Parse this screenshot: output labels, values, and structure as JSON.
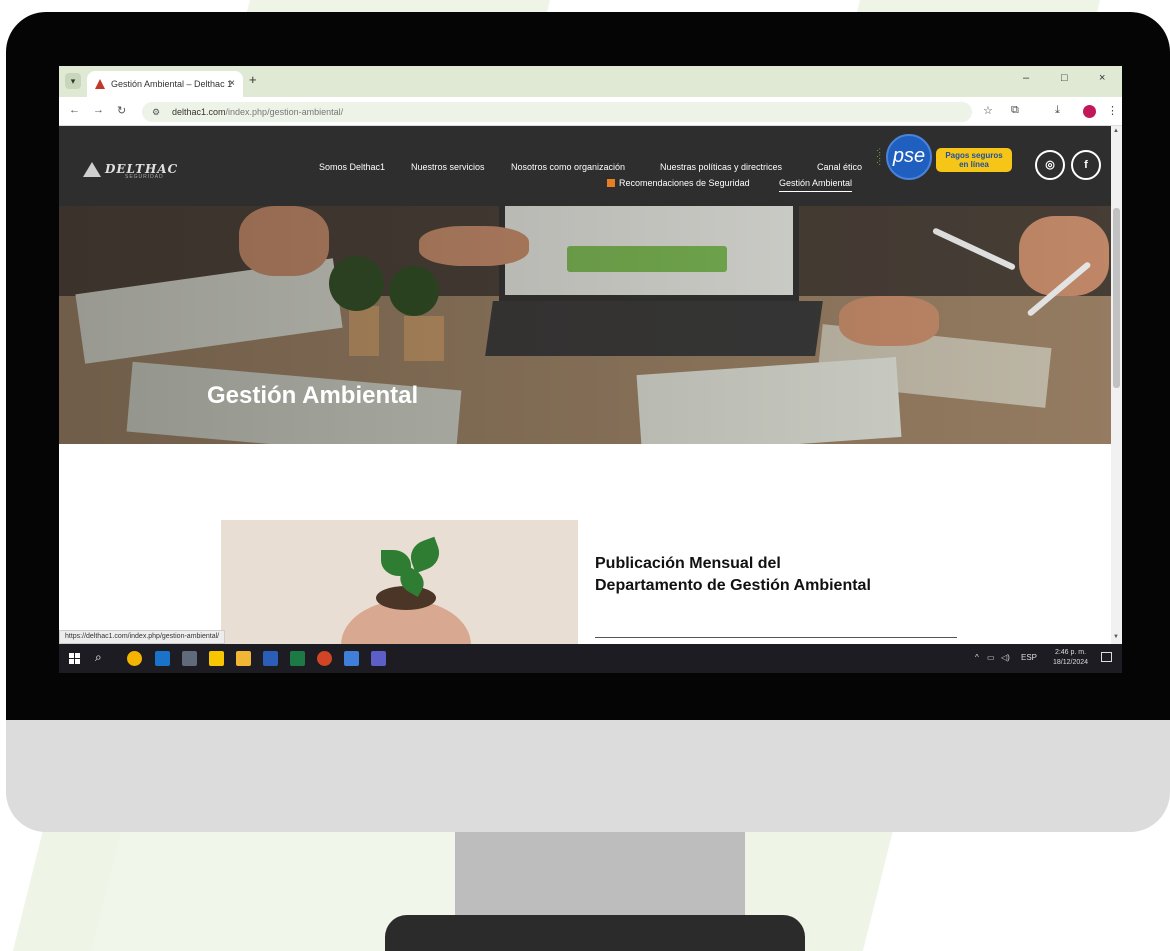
{
  "browser": {
    "tab_title": "Gestión Ambiental – Delthac 1",
    "tab_close": "×",
    "new_tab": "+",
    "url_host": "delthac1.com",
    "url_path": "/index.php/gestion-ambiental/",
    "window_controls": [
      "–",
      "□",
      "×"
    ]
  },
  "site": {
    "logo_text": "DELTHAC",
    "logo_subtext": "SEGURIDAD",
    "nav_row1": [
      "Somos Delthac1",
      "Nuestros servicios",
      "Nosotros como organización",
      "Nuestras políticas y directrices",
      "Canal ético"
    ],
    "nav_row2": [
      "Recomendaciones de Seguridad",
      "Gestión Ambiental"
    ],
    "active_nav": "Gestión Ambiental",
    "pse_label": "pse",
    "pse_pill": [
      "Pagos seguros",
      "en línea"
    ],
    "social": [
      "instagram",
      "facebook"
    ],
    "hero_title": "Gestión Ambiental",
    "publication_title_line1": "Publicación Mensual del",
    "publication_title_line2": "Departamento de Gestión Ambiental"
  },
  "status_bar": {
    "hover_url": "https://delthac1.com/index.php/gestion-ambiental/"
  },
  "taskbar": {
    "language": "ESP",
    "time": "2:46 p. m.",
    "date": "18/12/2024",
    "apps": [
      "chrome",
      "outlook",
      "calculator",
      "sticky-notes",
      "file-explorer",
      "word",
      "excel",
      "powerpoint",
      "photos",
      "teams"
    ]
  },
  "colors": {
    "site_header": "#2e2e2e",
    "pse_blue": "#1f5fbf",
    "pse_yellow": "#f5c518",
    "taskbar": "#1c1c22",
    "tab_strip": "#dfe9d4"
  }
}
